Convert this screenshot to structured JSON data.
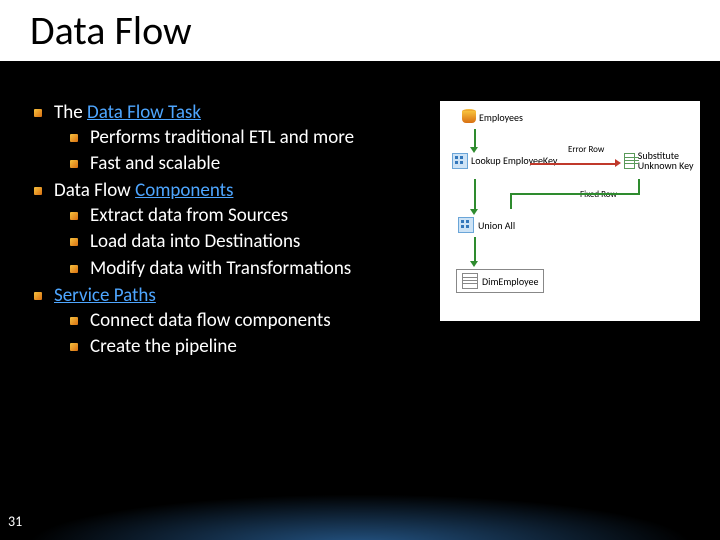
{
  "title": "Data Flow",
  "slide_number": "31",
  "bullets": {
    "b0": {
      "pre": "The ",
      "link": "Data Flow Task",
      "sub": [
        "Performs traditional ETL and more",
        "Fast and scalable"
      ]
    },
    "b1": {
      "pre": "Data Flow ",
      "link": "Components",
      "sub": [
        "Extract data from Sources",
        "Load data into Destinations",
        "Modify data with Transformations"
      ]
    },
    "b2": {
      "pre": "",
      "link": "Service Paths",
      "sub": [
        "Connect data flow components",
        "Create the pipeline"
      ]
    }
  },
  "diagram": {
    "n0": "Employees",
    "n1": "Lookup EmployeeKey",
    "n2": "Union All",
    "n3": "DimEmployee",
    "n4": "Substitute Unknown Key",
    "e0": "Error Row",
    "e1": "Fixed Row"
  }
}
